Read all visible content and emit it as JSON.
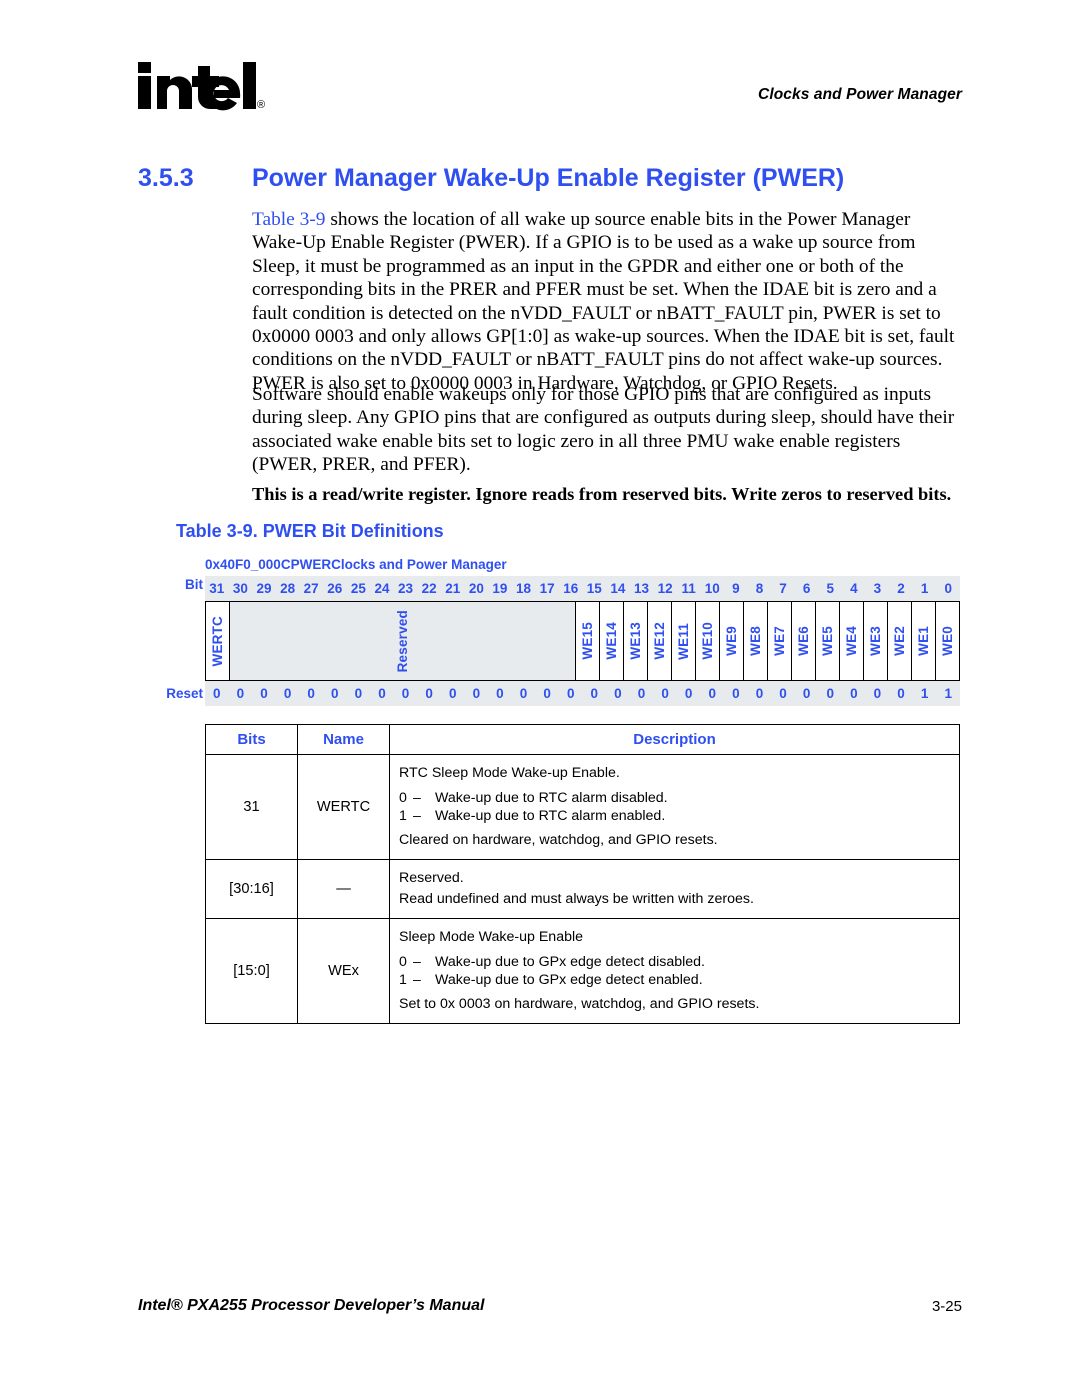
{
  "header": {
    "running_title": "Clocks and Power Manager"
  },
  "logo": {
    "wordmark": "intel",
    "registered_mark": "®"
  },
  "section": {
    "number": "3.5.3",
    "title": "Power Manager Wake-Up Enable Register (PWER)"
  },
  "body": {
    "paragraph1_xref": "Table 3-9",
    "paragraph1_rest": " shows the location of all wake up source enable bits in the Power Manager Wake-Up Enable Register (PWER). If a GPIO is to be used as a wake up source from Sleep, it must be programmed as an input in the GPDR and either one or both of the corresponding bits in the PRER and PFER must be set. When the IDAE bit is zero and a fault condition is detected on the nVDD_FAULT or nBATT_FAULT pin, PWER is set to 0x0000 0003 and only allows GP[1:0] as wake-up sources. When the IDAE bit is set, fault conditions on the nVDD_FAULT or nBATT_FAULT pins do not affect wake-up sources. PWER is also set to 0x0000 0003 in Hardware, Watchdog, or GPIO Resets.",
    "paragraph2": "Software should enable wakeups only for those GPIO pins that are configured as inputs during sleep. Any GPIO pins that are configured as outputs during sleep, should have their associated wake enable bits set to logic zero in all three PMU wake enable registers (PWER, PRER, and PFER).",
    "bold_note": "This is a read/write register. Ignore reads from reserved bits. Write zeros to reserved bits."
  },
  "table_caption": "Table 3-9. PWER Bit Definitions",
  "register_diagram": {
    "address": "0x40F0_000C",
    "register_name": "PWER",
    "unit": "Clocks and Power Manager",
    "bit_row_label": "Bit",
    "reset_row_label": "Reset",
    "bit_numbers": [
      "31",
      "30",
      "29",
      "28",
      "27",
      "26",
      "25",
      "24",
      "23",
      "22",
      "21",
      "20",
      "19",
      "18",
      "17",
      "16",
      "15",
      "14",
      "13",
      "12",
      "11",
      "10",
      "9",
      "8",
      "7",
      "6",
      "5",
      "4",
      "3",
      "2",
      "1",
      "0"
    ],
    "fields": [
      {
        "label": "WERTC",
        "span": 1,
        "reserved": false
      },
      {
        "label": "Reserved",
        "span": 15,
        "reserved": true
      },
      {
        "label": "WE15",
        "span": 1,
        "reserved": false
      },
      {
        "label": "WE14",
        "span": 1,
        "reserved": false
      },
      {
        "label": "WE13",
        "span": 1,
        "reserved": false
      },
      {
        "label": "WE12",
        "span": 1,
        "reserved": false
      },
      {
        "label": "WE11",
        "span": 1,
        "reserved": false
      },
      {
        "label": "WE10",
        "span": 1,
        "reserved": false
      },
      {
        "label": "WE9",
        "span": 1,
        "reserved": false
      },
      {
        "label": "WE8",
        "span": 1,
        "reserved": false
      },
      {
        "label": "WE7",
        "span": 1,
        "reserved": false
      },
      {
        "label": "WE6",
        "span": 1,
        "reserved": false
      },
      {
        "label": "WE5",
        "span": 1,
        "reserved": false
      },
      {
        "label": "WE4",
        "span": 1,
        "reserved": false
      },
      {
        "label": "WE3",
        "span": 1,
        "reserved": false
      },
      {
        "label": "WE2",
        "span": 1,
        "reserved": false
      },
      {
        "label": "WE1",
        "span": 1,
        "reserved": false
      },
      {
        "label": "WE0",
        "span": 1,
        "reserved": false
      }
    ],
    "reset_values": [
      "0",
      "0",
      "0",
      "0",
      "0",
      "0",
      "0",
      "0",
      "0",
      "0",
      "0",
      "0",
      "0",
      "0",
      "0",
      "0",
      "0",
      "0",
      "0",
      "0",
      "0",
      "0",
      "0",
      "0",
      "0",
      "0",
      "0",
      "0",
      "0",
      "0",
      "1",
      "1"
    ]
  },
  "definitions_table": {
    "columns": [
      "Bits",
      "Name",
      "Description"
    ],
    "rows": [
      {
        "bits": "31",
        "name": "WERTC",
        "description_head": "RTC Sleep Mode Wake-up Enable.",
        "bit_lines": [
          {
            "value": "0",
            "dash": "–",
            "text": "Wake-up due to RTC alarm disabled."
          },
          {
            "value": "1",
            "dash": "–",
            "text": "Wake-up due to RTC alarm enabled."
          }
        ],
        "description_tail": "Cleared on hardware, watchdog, and GPIO resets."
      },
      {
        "bits": "[30:16]",
        "name": "—",
        "description_head": "Reserved.",
        "bit_lines": [],
        "description_tail": "Read undefined and must always be written with zeroes."
      },
      {
        "bits": "[15:0]",
        "name": "WEx",
        "description_head": "Sleep Mode Wake-up Enable",
        "bit_lines": [
          {
            "value": "0",
            "dash": "–",
            "text": "Wake-up due to GPx edge detect disabled."
          },
          {
            "value": "1",
            "dash": "–",
            "text": "Wake-up due to GPx edge detect enabled."
          }
        ],
        "description_tail": "Set to 0x 0003 on hardware, watchdog, and GPIO resets."
      }
    ]
  },
  "footer": {
    "manual_title": "Intel® PXA255 Processor Developer’s Manual",
    "page_number": "3-25"
  },
  "colors": {
    "accent_blue": "#2f4ff0",
    "field_fill": "#e8ebed"
  }
}
